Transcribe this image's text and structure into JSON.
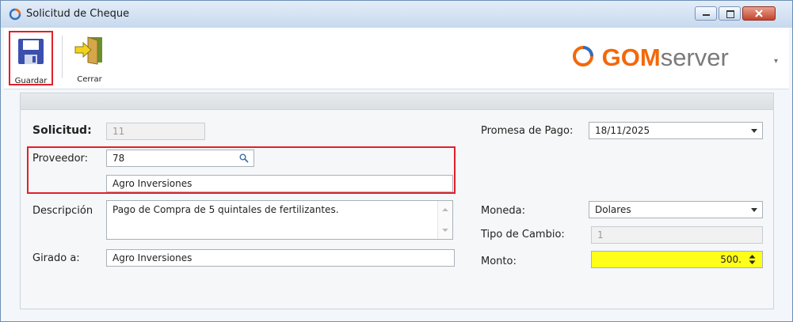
{
  "window": {
    "title": "Solicitud de Cheque",
    "colors": {
      "highlight": "#e0202a",
      "monto_bg": "#ffff1a",
      "logo_orange": "#f2690b"
    }
  },
  "toolbar": {
    "guardar_label": "Guardar",
    "cerrar_label": "Cerrar"
  },
  "logo": {
    "part1": "GOM",
    "part2": "server"
  },
  "form": {
    "solicitud_label": "Solicitud:",
    "solicitud_value": "11",
    "proveedor_label": "Proveedor:",
    "proveedor_value": "78",
    "proveedor_name": "Agro Inversiones",
    "descripcion_label": "Descripción",
    "descripcion_value": "Pago de Compra de 5 quintales de fertilizantes.",
    "girado_label": "Girado a:",
    "girado_value": "Agro Inversiones",
    "promesa_label": "Promesa de Pago:",
    "promesa_value": "18/11/2025",
    "moneda_label": "Moneda:",
    "moneda_value": "Dolares",
    "tipo_cambio_label": "Tipo de Cambio:",
    "tipo_cambio_value": "1",
    "monto_label": "Monto:",
    "monto_value": "500."
  }
}
